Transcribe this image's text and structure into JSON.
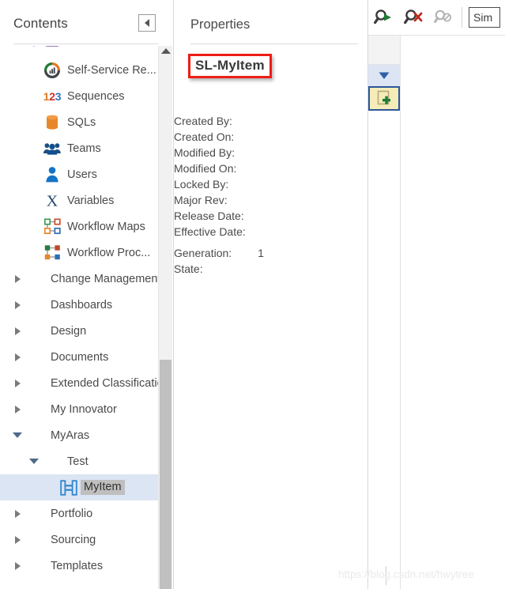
{
  "contents": {
    "title": "Contents",
    "collapse_icon": "triangle-left-icon",
    "tree_items": [
      {
        "label": "",
        "icon": "partial-row-icon",
        "indent": 1,
        "twisty": "down",
        "state": "partial",
        "selected": false
      },
      {
        "label": "Self-Service Re...",
        "icon": "donut-chart-icon",
        "indent": 1,
        "twisty": "none",
        "selected": false
      },
      {
        "label": "Sequences",
        "icon": "numbers-123-icon",
        "indent": 1,
        "twisty": "none",
        "selected": false
      },
      {
        "label": "SQLs",
        "icon": "database-cylinder-icon",
        "indent": 1,
        "twisty": "none",
        "selected": false
      },
      {
        "label": "Teams",
        "icon": "people-group-icon",
        "indent": 1,
        "twisty": "none",
        "selected": false
      },
      {
        "label": "Users",
        "icon": "person-icon",
        "indent": 1,
        "twisty": "none",
        "selected": false
      },
      {
        "label": "Variables",
        "icon": "letter-x-icon",
        "indent": 1,
        "twisty": "none",
        "selected": false
      },
      {
        "label": "Workflow Maps",
        "icon": "workflow-map-icon",
        "indent": 1,
        "twisty": "none",
        "selected": false
      },
      {
        "label": "Workflow Proc...",
        "icon": "workflow-process-icon",
        "indent": 1,
        "twisty": "none",
        "selected": false
      },
      {
        "label": "Change Management",
        "icon": "none",
        "indent": 0,
        "twisty": "right",
        "selected": false
      },
      {
        "label": "Dashboards",
        "icon": "none",
        "indent": 0,
        "twisty": "right",
        "selected": false
      },
      {
        "label": "Design",
        "icon": "none",
        "indent": 0,
        "twisty": "right",
        "selected": false
      },
      {
        "label": "Documents",
        "icon": "none",
        "indent": 0,
        "twisty": "right",
        "selected": false
      },
      {
        "label": "Extended Classification",
        "icon": "none",
        "indent": 0,
        "twisty": "right",
        "selected": false
      },
      {
        "label": "My Innovator",
        "icon": "none",
        "indent": 0,
        "twisty": "right",
        "selected": false
      },
      {
        "label": "MyAras",
        "icon": "none",
        "indent": 0,
        "twisty": "down",
        "selected": false
      },
      {
        "label": "Test",
        "icon": "none",
        "indent": 1,
        "twisty": "down",
        "selected": false
      },
      {
        "label": "MyItem",
        "icon": "ibeam-item-icon",
        "indent": 2,
        "twisty": "none",
        "selected": true
      },
      {
        "label": "Portfolio",
        "icon": "none",
        "indent": 0,
        "twisty": "right",
        "selected": false
      },
      {
        "label": "Sourcing",
        "icon": "none",
        "indent": 0,
        "twisty": "right",
        "selected": false
      },
      {
        "label": "Templates",
        "icon": "none",
        "indent": 0,
        "twisty": "right",
        "selected": false
      }
    ],
    "scrollbar": {
      "up_arrow_icon": "triangle-up-icon"
    }
  },
  "properties": {
    "title": "Properties",
    "item_name": "SL-MyItem",
    "highlight_color": "#ee1d16",
    "rows": [
      {
        "label": "Created By:",
        "value": ""
      },
      {
        "label": "Created On:",
        "value": ""
      },
      {
        "label": "Modified By:",
        "value": ""
      },
      {
        "label": "Modified On:",
        "value": ""
      },
      {
        "label": "Locked By:",
        "value": ""
      },
      {
        "label": "Major Rev:",
        "value": ""
      },
      {
        "label": "Release Date:",
        "value": ""
      },
      {
        "label": "Effective Date:",
        "value": ""
      },
      {
        "label": "Generation:",
        "value": "1"
      },
      {
        "label": "State:",
        "value": ""
      }
    ]
  },
  "right_panel": {
    "toolbar": [
      {
        "name": "run-search-button",
        "icon": "magnifier-play-icon",
        "enabled": true
      },
      {
        "name": "clear-search-button",
        "icon": "magnifier-x-icon",
        "enabled": true
      },
      {
        "name": "cancel-search-button",
        "icon": "magnifier-disabled-icon",
        "enabled": false
      }
    ],
    "search_input": {
      "value": "Sim",
      "placeholder": "Simple Search"
    },
    "grid": {
      "filter_row_icon": "funnel-triangle-icon",
      "new_row_icon": "new-item-plus-icon",
      "filter_row_color": "#dde5f5",
      "new_row_color": "#f5ecb8",
      "new_row_border_color": "#2b579a"
    }
  },
  "watermark": {
    "text": "https://blog.csdn.net/hwytree"
  }
}
